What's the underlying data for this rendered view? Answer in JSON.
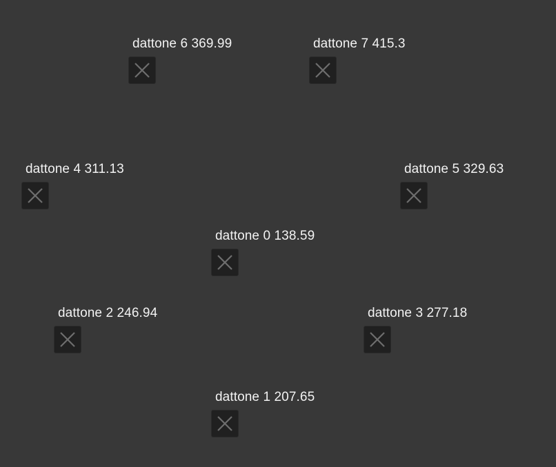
{
  "nodes": [
    {
      "id": "dattone-6",
      "label": "dattone 6 369.99",
      "icon": "close-icon"
    },
    {
      "id": "dattone-7",
      "label": "dattone 7 415.3",
      "icon": "close-icon"
    },
    {
      "id": "dattone-4",
      "label": "dattone 4 311.13",
      "icon": "close-icon"
    },
    {
      "id": "dattone-5",
      "label": "dattone 5 329.63",
      "icon": "close-icon"
    },
    {
      "id": "dattone-0",
      "label": "dattone 0 138.59",
      "icon": "close-icon"
    },
    {
      "id": "dattone-2",
      "label": "dattone 2 246.94",
      "icon": "close-icon"
    },
    {
      "id": "dattone-3",
      "label": "dattone 3 277.18",
      "icon": "close-icon"
    },
    {
      "id": "dattone-1",
      "label": "dattone 1 207.65",
      "icon": "close-icon"
    }
  ],
  "colors": {
    "background": "#383838",
    "button": "#202020",
    "icon": "#6e6e6e",
    "text": "#f2f2f2"
  }
}
